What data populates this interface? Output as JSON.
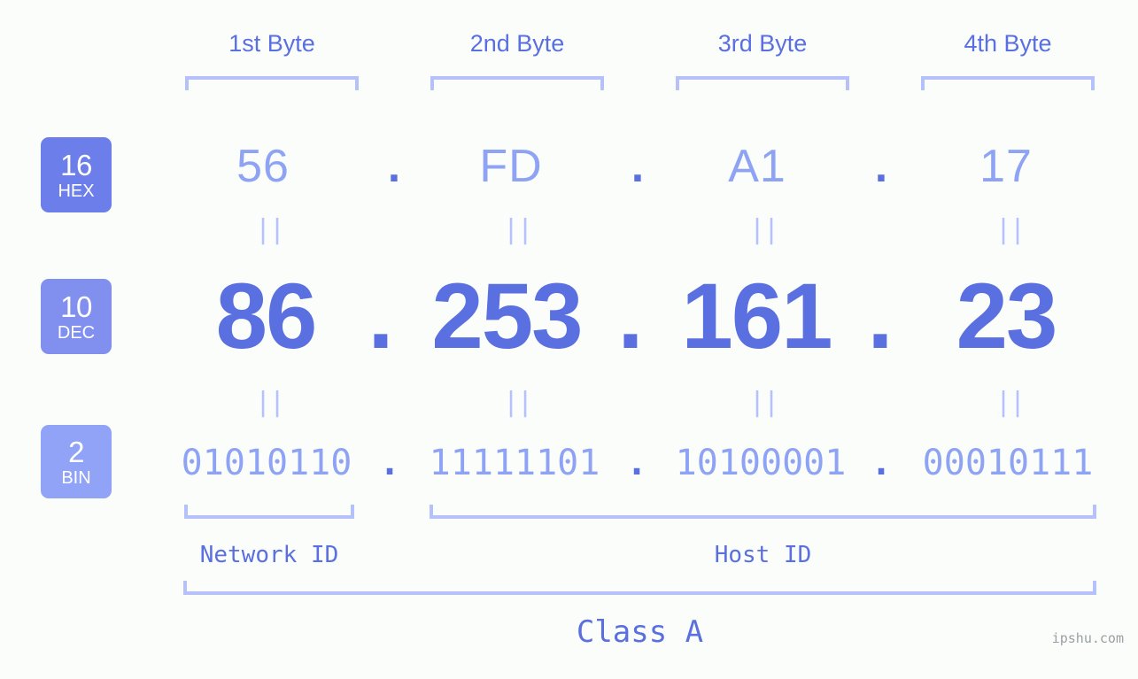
{
  "background_color": "#fbfdfa",
  "accent_strong": "#5a6fe0",
  "accent_light": "#8fa3f5",
  "accent_pale": "#b6c0fb",
  "byte_headers": [
    {
      "label": "1st Byte"
    },
    {
      "label": "2nd Byte"
    },
    {
      "label": "3rd Byte"
    },
    {
      "label": "4th Byte"
    }
  ],
  "rows": {
    "hex": {
      "badge_number": "16",
      "badge_label": "HEX",
      "values": [
        "56",
        "FD",
        "A1",
        "17"
      ],
      "separator": "."
    },
    "dec": {
      "badge_number": "10",
      "badge_label": "DEC",
      "values": [
        "86",
        "253",
        "161",
        "23"
      ],
      "separator": "."
    },
    "bin": {
      "badge_number": "2",
      "badge_label": "BIN",
      "values": [
        "01010110",
        "11111101",
        "10100001",
        "00010111"
      ],
      "separator": "."
    }
  },
  "equals_symbol": "||",
  "segments": {
    "network_id": "Network ID",
    "host_id": "Host ID",
    "class": "Class A"
  },
  "watermark": "ipshu.com"
}
